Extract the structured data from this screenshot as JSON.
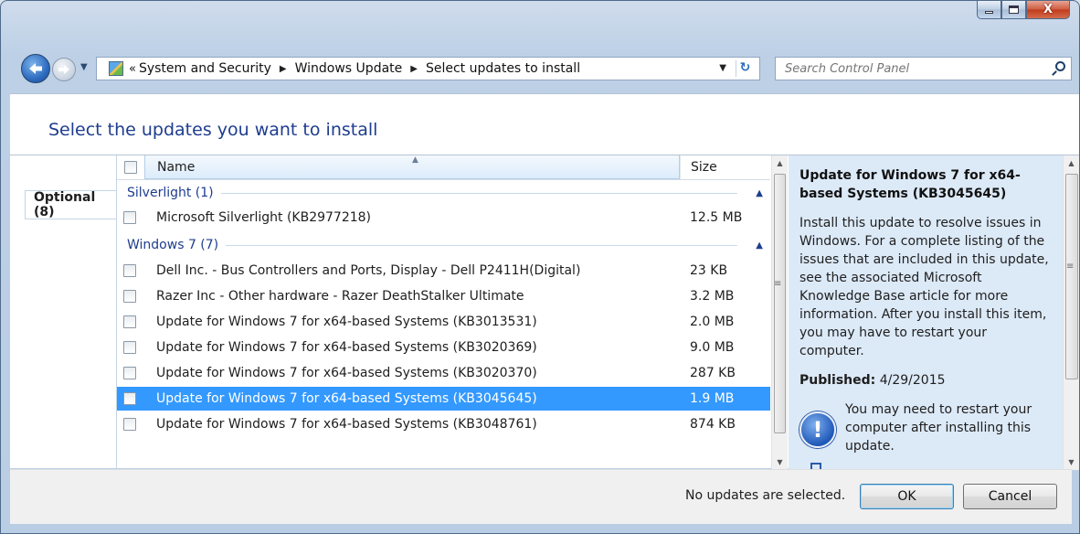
{
  "window": {
    "caption_buttons": {
      "close_label": "X"
    }
  },
  "navbar": {
    "breadcrumb_prefix": "«",
    "breadcrumbs": [
      "System and Security",
      "Windows Update",
      "Select updates to install"
    ],
    "search_placeholder": "Search Control Panel"
  },
  "page": {
    "title": "Select the updates you want to install"
  },
  "tabs": {
    "optional": "Optional (8)"
  },
  "columns": {
    "name": "Name",
    "size": "Size"
  },
  "groups": [
    {
      "label": "Silverlight (1)",
      "items": [
        {
          "name": "Microsoft Silverlight (KB2977218)",
          "size": "12.5 MB",
          "checked": false,
          "selected": false
        }
      ]
    },
    {
      "label": "Windows 7 (7)",
      "items": [
        {
          "name": "Dell Inc. - Bus Controllers and Ports, Display - Dell P2411H(Digital)",
          "size": "23 KB",
          "checked": false,
          "selected": false
        },
        {
          "name": "Razer Inc - Other hardware - Razer DeathStalker Ultimate",
          "size": "3.2 MB",
          "checked": false,
          "selected": false
        },
        {
          "name": "Update for Windows 7 for x64-based Systems (KB3013531)",
          "size": "2.0 MB",
          "checked": false,
          "selected": false
        },
        {
          "name": "Update for Windows 7 for x64-based Systems (KB3020369)",
          "size": "9.0 MB",
          "checked": false,
          "selected": false
        },
        {
          "name": "Update for Windows 7 for x64-based Systems (KB3020370)",
          "size": "287 KB",
          "checked": false,
          "selected": false
        },
        {
          "name": "Update for Windows 7 for x64-based Systems (KB3045645)",
          "size": "1.9 MB",
          "checked": false,
          "selected": true
        },
        {
          "name": "Update for Windows 7 for x64-based Systems (KB3048761)",
          "size": "874 KB",
          "checked": false,
          "selected": false
        }
      ]
    }
  ],
  "details": {
    "title": "Update for Windows 7 for x64-based Systems (KB3045645)",
    "description": "Install this update to resolve issues in Windows. For a complete listing of the issues that are included in this update, see the associated Microsoft Knowledge Base article for more information. After you install this item, you may have to restart your computer.",
    "published_label": "Published:",
    "published_date": "4/29/2015",
    "restart_warning": "You may need to restart your computer after installing this update."
  },
  "footer": {
    "status": "No updates are selected.",
    "ok_label": "OK",
    "cancel_label": "Cancel"
  },
  "colors": {
    "title_blue": "#1e3d8f",
    "selection": "#3399ff",
    "details_bg": "#dce9f7"
  },
  "icons": [
    "back-arrow-icon",
    "forward-arrow-icon",
    "control-panel-icon",
    "refresh-icon",
    "search-icon",
    "collapse-chevron-icon",
    "info-shield-icon"
  ]
}
